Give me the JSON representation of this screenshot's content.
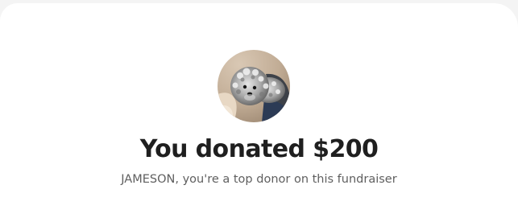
{
  "donation": {
    "headline": "You donated $200",
    "message": "JAMESON, you're a top donor on this fundraiser"
  },
  "avatar": {
    "subject": "dog-photo"
  }
}
